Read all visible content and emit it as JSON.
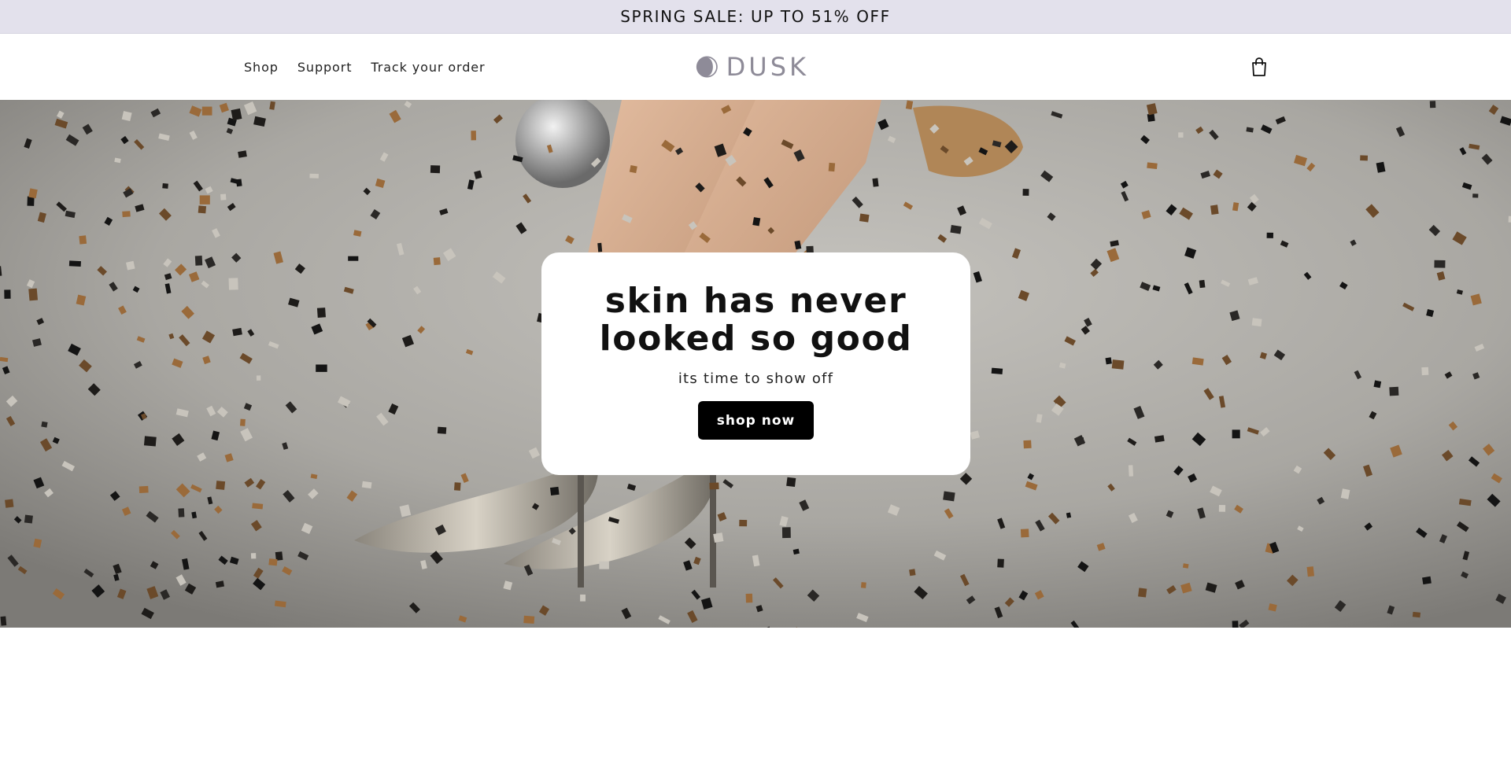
{
  "announcement": {
    "text": "SPRING SALE: UP TO 51% OFF"
  },
  "header": {
    "nav": [
      {
        "label": "Shop"
      },
      {
        "label": "Support"
      },
      {
        "label": "Track your order"
      }
    ],
    "logo_text": "DUSK",
    "cart_icon": "shopping-bag-icon"
  },
  "hero": {
    "title": "skin has never looked so good",
    "subtitle": "its time to show off",
    "cta_label": "shop now"
  },
  "colors": {
    "announcement_bg": "#e3e1ec",
    "logo_color": "#8e8b98",
    "cta_bg": "#000000",
    "card_bg": "#ffffff"
  }
}
